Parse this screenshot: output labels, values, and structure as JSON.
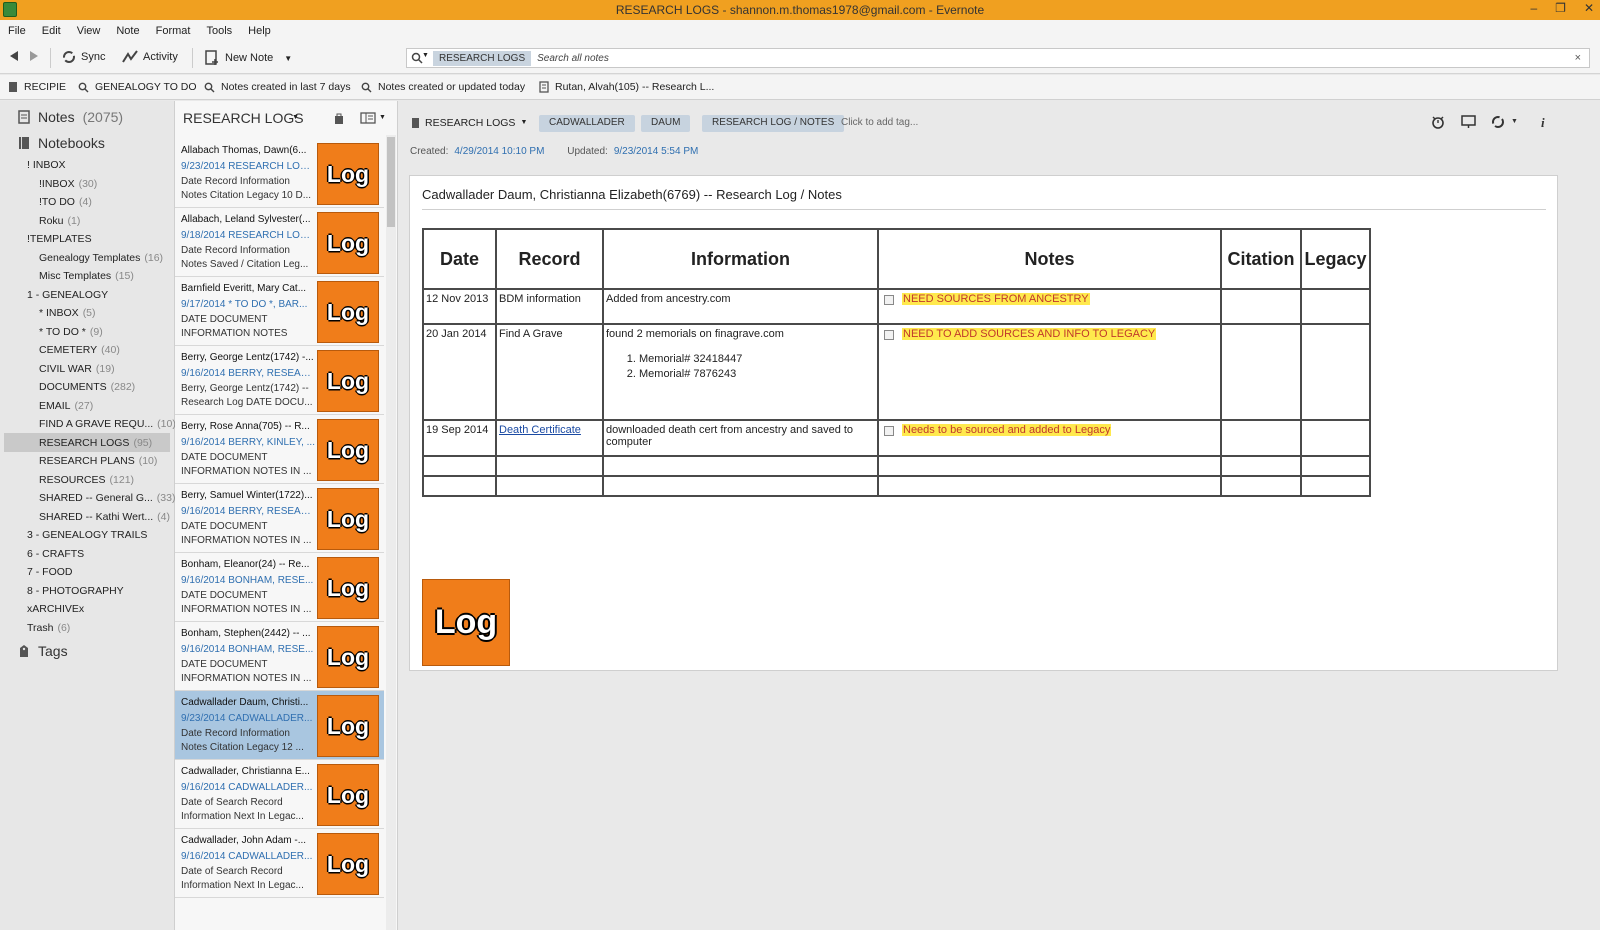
{
  "window": {
    "title": "RESEARCH LOGS - shannon.m.thomas1978@gmail.com - Evernote",
    "controls": [
      "–",
      "❐",
      "✕"
    ]
  },
  "menu": [
    "File",
    "Edit",
    "View",
    "Note",
    "Format",
    "Tools",
    "Help"
  ],
  "toolbar": {
    "sync_label": "Sync",
    "activity_label": "Activity",
    "new_note_label": "New Note",
    "search_scope": "RESEARCH LOGS",
    "search_placeholder": "Search all notes",
    "search_close": "×"
  },
  "shortcuts": [
    {
      "label": "RECIPIE",
      "icon": "notebook-icon"
    },
    {
      "label": "GENEALOGY TO DO",
      "icon": "search-icon"
    },
    {
      "label": "Notes created in last 7 days",
      "icon": "search-icon"
    },
    {
      "label": "Notes created or updated today",
      "icon": "search-icon"
    },
    {
      "label": "Rutan, Alvah(105) -- Research L...",
      "icon": "note-icon"
    }
  ],
  "sidebar": {
    "notes_label": "Notes",
    "notes_count": "(2075)",
    "notebooks_label": "Notebooks",
    "tags_label": "Tags",
    "items": [
      {
        "label": "! INBOX",
        "count": "",
        "indent": 0
      },
      {
        "label": "!INBOX",
        "count": "(30)",
        "indent": 1
      },
      {
        "label": "!TO DO",
        "count": "(4)",
        "indent": 1
      },
      {
        "label": "Roku",
        "count": "(1)",
        "indent": 1
      },
      {
        "label": "!TEMPLATES",
        "count": "",
        "indent": 0
      },
      {
        "label": "Genealogy Templates",
        "count": "(16)",
        "indent": 1
      },
      {
        "label": "Misc Templates",
        "count": "(15)",
        "indent": 1
      },
      {
        "label": "1 - GENEALOGY",
        "count": "",
        "indent": 0
      },
      {
        "label": "* INBOX",
        "count": "(5)",
        "indent": 1
      },
      {
        "label": "* TO DO *",
        "count": "(9)",
        "indent": 1
      },
      {
        "label": "CEMETERY",
        "count": "(40)",
        "indent": 1
      },
      {
        "label": "CIVIL WAR",
        "count": "(19)",
        "indent": 1
      },
      {
        "label": "DOCUMENTS",
        "count": "(282)",
        "indent": 1
      },
      {
        "label": "EMAIL",
        "count": "(27)",
        "indent": 1
      },
      {
        "label": "FIND A GRAVE REQU...",
        "count": "(10)",
        "indent": 1
      },
      {
        "label": "RESEARCH LOGS",
        "count": "(95)",
        "indent": 1
      },
      {
        "label": "RESEARCH PLANS",
        "count": "(10)",
        "indent": 1
      },
      {
        "label": "RESOURCES",
        "count": "(121)",
        "indent": 1
      },
      {
        "label": "SHARED -- General G...",
        "count": "(33)",
        "indent": 1
      },
      {
        "label": "SHARED -- Kathi Wert...",
        "count": "(4)",
        "indent": 1
      },
      {
        "label": "3 - GENEALOGY TRAILS",
        "count": "",
        "indent": 0
      },
      {
        "label": "6 - CRAFTS",
        "count": "",
        "indent": 0
      },
      {
        "label": "7 - FOOD",
        "count": "",
        "indent": 0
      },
      {
        "label": "8 - PHOTOGRAPHY",
        "count": "",
        "indent": 0
      },
      {
        "label": "xARCHIVEx",
        "count": "",
        "indent": 0
      },
      {
        "label": "Trash",
        "count": "(6)",
        "indent": 0
      }
    ]
  },
  "notelist": {
    "title": "RESEARCH LOGS",
    "thumb_text": "Log",
    "notes": [
      {
        "title": "Allabach Thomas, Dawn(6...",
        "meta": "9/23/2014  RESEARCH LOG...",
        "snippet": "Date Record Information Notes Citation Legacy 10 D..."
      },
      {
        "title": "Allabach, Leland Sylvester(...",
        "meta": "9/18/2014  RESEARCH LOG...",
        "snippet": "Date Record Information Notes Saved / Citation Leg..."
      },
      {
        "title": "Barnfield Everitt, Mary Cat...",
        "meta": "9/17/2014  * TO DO *, BAR...",
        "snippet": "DATE DOCUMENT INFORMATION NOTES Sav..."
      },
      {
        "title": "Berry, George Lentz(1742) -...",
        "meta": "9/16/2014  BERRY, RESEAR...",
        "snippet": "Berry, George Lentz(1742) -- Research Log DATE DOCU..."
      },
      {
        "title": "Berry, Rose Anna(705) -- R...",
        "meta": "9/16/2014  BERRY, KINLEY, ...",
        "snippet": "DATE DOCUMENT INFORMATION NOTES IN ..."
      },
      {
        "title": "Berry, Samuel Winter(1722)...",
        "meta": "9/16/2014  BERRY, RESEAR...",
        "snippet": "DATE DOCUMENT INFORMATION NOTES IN ..."
      },
      {
        "title": "Bonham, Eleanor(24) -- Re...",
        "meta": "9/16/2014  BONHAM, RESE...",
        "snippet": "DATE DOCUMENT INFORMATION NOTES IN ..."
      },
      {
        "title": "Bonham, Stephen(2442) -- ...",
        "meta": "9/16/2014  BONHAM, RESE...",
        "snippet": "DATE DOCUMENT INFORMATION NOTES IN ..."
      },
      {
        "title": "Cadwallader Daum, Christi...",
        "meta": "9/23/2014  CADWALLADER...",
        "snippet": "Date Record Information Notes Citation Legacy 12 ..."
      },
      {
        "title": "Cadwallader, Christianna E...",
        "meta": "9/16/2014  CADWALLADER...",
        "snippet": "Date of Search Record Information Next In Legac..."
      },
      {
        "title": "Cadwallader, John Adam -...",
        "meta": "9/16/2014  CADWALLADER...",
        "snippet": "Date of Search Record Information Next In Legac..."
      }
    ]
  },
  "editor": {
    "notebook": "RESEARCH LOGS",
    "tags": [
      "CADWALLADER",
      "DAUM",
      "RESEARCH LOG / NOTES"
    ],
    "tag_prompt": "Click to add tag...",
    "created_label": "Created:",
    "created_value": "4/29/2014 10:10 PM",
    "updated_label": "Updated:",
    "updated_value": "9/23/2014 5:54 PM",
    "note_title": "Cadwallader Daum, Christianna Elizabeth(6769)  -- Research Log / Notes",
    "big_thumb_text": "Log",
    "table": {
      "headers": [
        "Date",
        "Record",
        "Information",
        "Notes",
        "Citation",
        "Legacy"
      ],
      "rows": [
        {
          "date": "12 Nov 2013",
          "record": "BDM information",
          "info": "Added from ancestry.com",
          "note": "NEED SOURCES FROM ANCESTRY"
        },
        {
          "date": "20 Jan 2014",
          "record": "Find A Grave",
          "info": "found 2 memorials on finagrave.com",
          "list": [
            "Memorial# 32418447",
            "Memorial# 7876243"
          ],
          "note": "NEED TO ADD SOURCES AND INFO TO LEGACY"
        },
        {
          "date": "19 Sep 2014",
          "record": "Death Certificate",
          "info": "downloaded death cert from ancestry and saved to computer",
          "note": "Needs to be sourced and added to Legacy"
        }
      ]
    }
  },
  "colors": {
    "titlebar": "#f0a020",
    "selected_note": "#a9c6e0",
    "log_orange": "#f07d1a",
    "highlight": "#ffe94d",
    "highlight_text": "#c0392b",
    "link": "#1a4aa3"
  }
}
